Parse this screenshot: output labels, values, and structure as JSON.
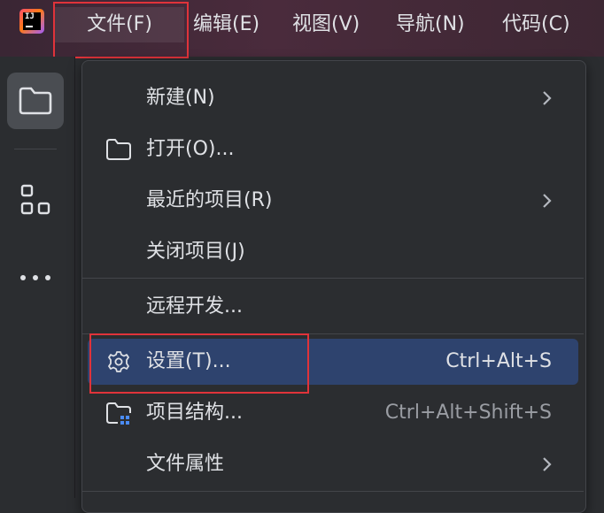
{
  "menubar": {
    "items": [
      {
        "label": "文件(F)"
      },
      {
        "label": "编辑(E)"
      },
      {
        "label": "视图(V)"
      },
      {
        "label": "导航(N)"
      },
      {
        "label": "代码(C)"
      }
    ]
  },
  "logo_text": "IJ",
  "toolstrip": {
    "buttons": [
      {
        "icon": "folder-icon"
      },
      {
        "icon": "structure-icon"
      },
      {
        "icon": "more-icon"
      }
    ]
  },
  "file_menu": {
    "items": [
      {
        "label": "新建(N)",
        "shortcut": "",
        "icon": "",
        "submenu": true
      },
      {
        "label": "打开(O)...",
        "shortcut": "",
        "icon": "folder-icon",
        "submenu": false
      },
      {
        "label": "最近的项目(R)",
        "shortcut": "",
        "icon": "",
        "submenu": true
      },
      {
        "label": "关闭项目(J)",
        "shortcut": "",
        "icon": "",
        "submenu": false
      },
      {
        "label": "远程开发...",
        "shortcut": "",
        "icon": "",
        "submenu": false
      },
      {
        "label": "设置(T)...",
        "shortcut": "Ctrl+Alt+S",
        "icon": "gear-icon",
        "submenu": false,
        "highlighted": true
      },
      {
        "label": "项目结构...",
        "shortcut": "Ctrl+Alt+Shift+S",
        "icon": "project-structure-icon",
        "submenu": false
      },
      {
        "label": "文件属性",
        "shortcut": "",
        "icon": "",
        "submenu": true
      }
    ]
  },
  "colors": {
    "highlight": "#2e436e",
    "annotation_box": "#e0333a",
    "menubar_bg": "#4a2b3c"
  }
}
